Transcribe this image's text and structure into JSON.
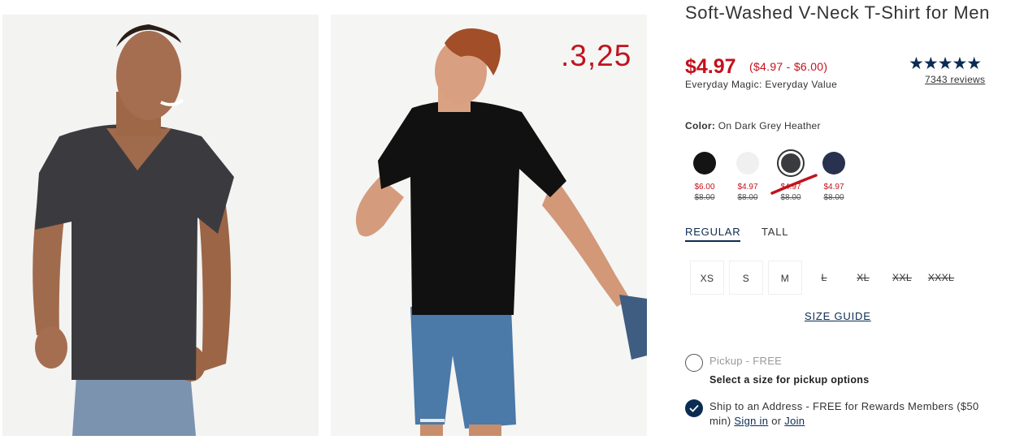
{
  "overlay_number": ".3,25",
  "product": {
    "title": "Soft-Washed V-Neck T-Shirt for Men",
    "price": "$4.97",
    "price_range": "($4.97 - $6.00)",
    "tagline": "Everyday Magic: Everyday Value",
    "stars": "★★★★★",
    "reviews": "7343 reviews"
  },
  "color": {
    "label": "Color:",
    "selected_name": "On Dark Grey Heather",
    "swatches": [
      {
        "name": "black",
        "hex": "#141414",
        "now": "$6.00",
        "was": "$8.00",
        "selected": false
      },
      {
        "name": "white",
        "hex": "#f0f0f0",
        "now": "$4.97",
        "was": "$8.00",
        "selected": false
      },
      {
        "name": "dark-grey-heather",
        "hex": "#3a3b3e",
        "now": "$4.97",
        "was": "$8.00",
        "selected": true
      },
      {
        "name": "navy",
        "hex": "#28324f",
        "now": "$4.97",
        "was": "$8.00",
        "selected": false
      }
    ]
  },
  "fit_tabs": [
    {
      "label": "REGULAR",
      "active": true
    },
    {
      "label": "TALL",
      "active": false
    }
  ],
  "sizes": [
    {
      "label": "XS",
      "available": true
    },
    {
      "label": "S",
      "available": true
    },
    {
      "label": "M",
      "available": true
    },
    {
      "label": "L",
      "available": false
    },
    {
      "label": "XL",
      "available": false
    },
    {
      "label": "XXL",
      "available": false
    },
    {
      "label": "XXXL",
      "available": false
    }
  ],
  "size_guide": "SIZE GUIDE",
  "pickup": {
    "label": "Pickup - FREE",
    "sub": "Select a size for pickup options"
  },
  "ship": {
    "line1": "Ship to an Address - FREE for Rewards Members ($50",
    "line2_prefix": "min)",
    "sign_in": "Sign in",
    "or": "or",
    "join": "Join"
  },
  "colors": {
    "accent_red": "#c4111d",
    "navy": "#0b2c52",
    "annotation_red": "#c0141e"
  }
}
